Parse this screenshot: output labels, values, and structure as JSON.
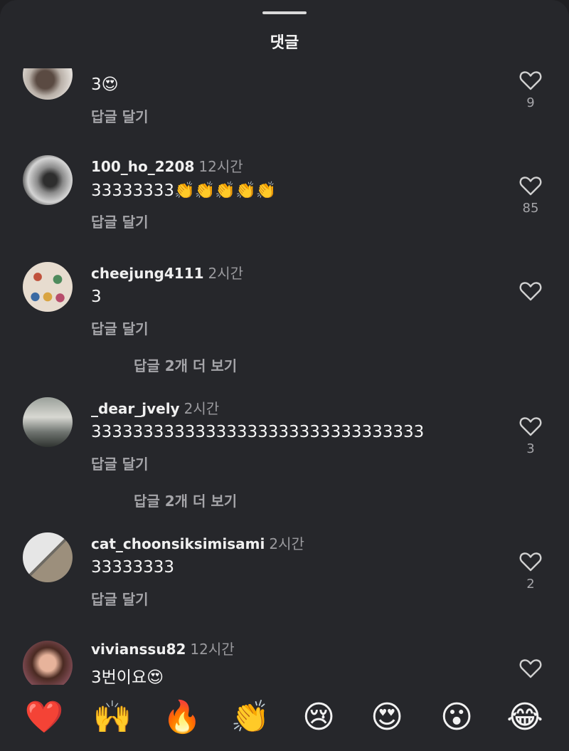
{
  "sheet": {
    "title": "댓글"
  },
  "reply_label": "답글 달기",
  "comments": [
    {
      "username": "",
      "time": "",
      "text": "3😍",
      "likes": "9"
    },
    {
      "username": "100_ho_2208",
      "time": "12시간",
      "text": "33333333👏👏👏👏👏",
      "likes": "85"
    },
    {
      "username": "cheejung4111",
      "time": "2시간",
      "text": "3",
      "likes": "",
      "more_replies": "답글 2개 더 보기"
    },
    {
      "username": "_dear_jvely",
      "time": "2시간",
      "text": "33333333333333333333333333333333",
      "likes": "3",
      "more_replies": "답글 2개 더 보기"
    },
    {
      "username": "cat_choonsiksimisami",
      "time": "2시간",
      "text": "33333333",
      "likes": "2"
    },
    {
      "username": "vivianssu82",
      "time": "12시간",
      "text": "3번이요😍",
      "likes": ""
    }
  ],
  "emoji_bar": [
    "❤️",
    "🙌",
    "🔥",
    "👏",
    "😢",
    "😍",
    "😮",
    "😂"
  ],
  "colors": {
    "background": "#26272b",
    "secondary_text": "#a5a5a9",
    "heart_outline": "#d0d0d0"
  },
  "icons": {
    "like": "heart-outline-icon"
  }
}
